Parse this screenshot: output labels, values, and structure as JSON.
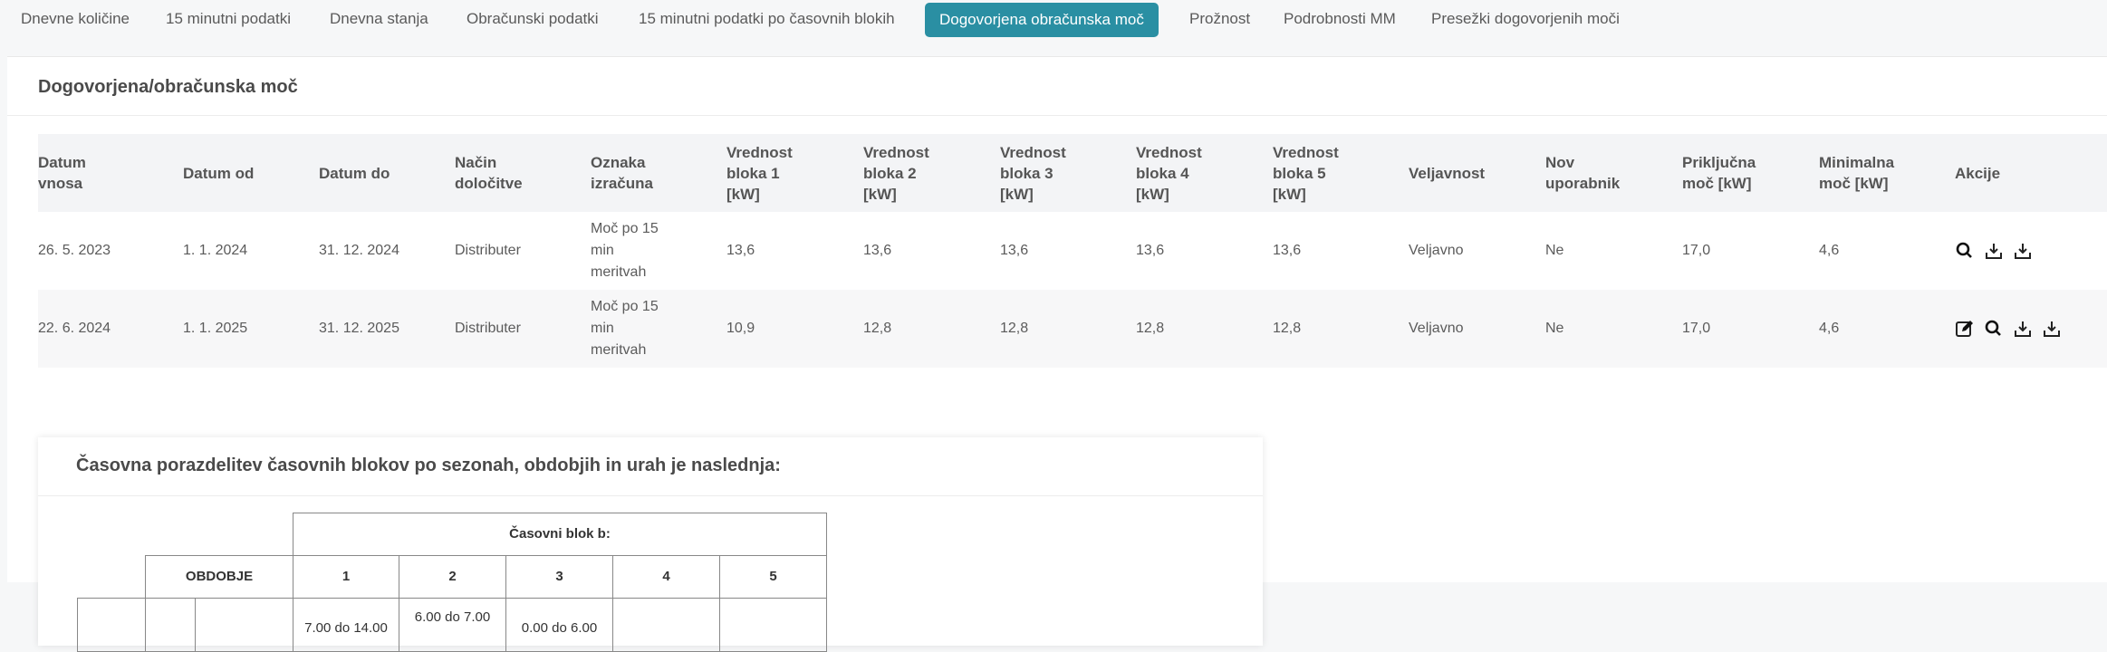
{
  "tabs": [
    {
      "label": "Dnevne količine",
      "active": false
    },
    {
      "label": "15 minutni podatki",
      "active": false
    },
    {
      "label": "Dnevna stanja",
      "active": false
    },
    {
      "label": "Obračunski podatki",
      "active": false
    },
    {
      "label": "15 minutni podatki po časovnih blokih",
      "active": false
    },
    {
      "label": "Dogovorjena obračunska moč",
      "active": true
    },
    {
      "label": "Prožnost",
      "active": false
    },
    {
      "label": "Podrobnosti MM",
      "active": false
    },
    {
      "label": "Presežki dogovorjenih moči",
      "active": false
    }
  ],
  "main": {
    "title": "Dogovorjena/obračunska moč",
    "headers": [
      "Datum vnosa",
      "Datum od",
      "Datum do",
      "Način določitve",
      "Oznaka izračuna",
      "Vrednost bloka 1 [kW]",
      "Vrednost bloka 2 [kW]",
      "Vrednost bloka 3 [kW]",
      "Vrednost bloka 4 [kW]",
      "Vrednost bloka 5 [kW]",
      "Veljavnost",
      "Nov uporabnik",
      "Priključna moč [kW]",
      "Minimalna moč [kW]",
      "Akcije"
    ],
    "rows": [
      [
        "26. 5. 2023",
        "1. 1. 2024",
        "31. 12. 2024",
        "Distributer",
        "Moč po 15 min meritvah",
        "13,6",
        "13,6",
        "13,6",
        "13,6",
        "13,6",
        "Veljavno",
        "Ne",
        "17,0",
        "4,6"
      ],
      [
        "22. 6. 2024",
        "1. 1. 2025",
        "31. 12. 2025",
        "Distributer",
        "Moč po 15 min meritvah",
        "10,9",
        "12,8",
        "12,8",
        "12,8",
        "12,8",
        "Veljavno",
        "Ne",
        "17,0",
        "4,6"
      ]
    ],
    "row_actions": [
      [
        "search-icon",
        "download-icon",
        "download-icon"
      ],
      [
        "edit-icon",
        "search-icon",
        "download-icon",
        "download-icon"
      ]
    ]
  },
  "periods": {
    "title": "Časovna porazdelitev časovnih blokov po sezonah, obdobjih in urah je naslednja:",
    "block_header": "Časovni blok b:",
    "period_header": "OBDOBJE",
    "blocks": [
      "1",
      "2",
      "3",
      "4",
      "5"
    ],
    "partial_cells": [
      "7.00 do 14.00",
      "6.00 do 7.00",
      "0.00 do 6.00"
    ]
  },
  "colors": {
    "accent": "#2a8fa3",
    "header_bg": "#f3f4f6"
  }
}
